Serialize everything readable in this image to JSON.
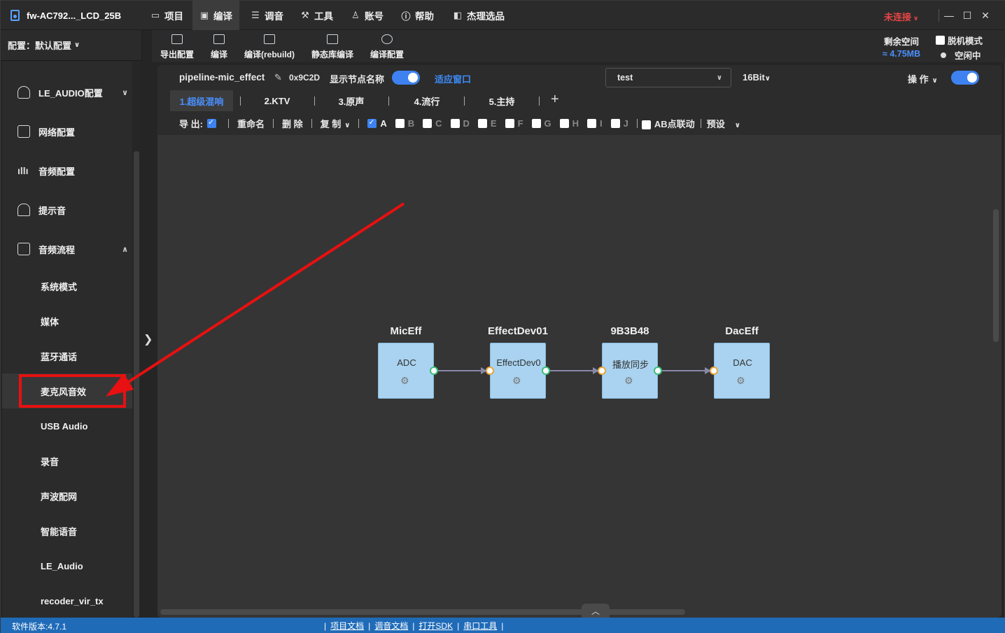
{
  "title_bar": {
    "app_title": "fw-AC792..._LCD_25B",
    "menus": [
      {
        "label": "项目",
        "icon": "folder-icon"
      },
      {
        "label": "编译",
        "icon": "compile-icon"
      },
      {
        "label": "调音",
        "icon": "document-icon"
      },
      {
        "label": "工具",
        "icon": "tools-icon"
      },
      {
        "label": "账号",
        "icon": "user-icon"
      },
      {
        "label": "帮助",
        "icon": "help-icon"
      },
      {
        "label": "杰理选品",
        "icon": "product-icon"
      }
    ],
    "active_menu": "编译",
    "connection_status": "未连接",
    "connection_color": "#e84545"
  },
  "config_selector": {
    "label": "配置：默认配置"
  },
  "toolbar": {
    "buttons": [
      {
        "label": "导出配置",
        "icon": "export-icon"
      },
      {
        "label": "编译",
        "icon": "compile-icon"
      },
      {
        "label": "编译(rebuild)",
        "icon": "rebuild-icon"
      },
      {
        "label": "静态库编译",
        "icon": "static-lib-icon"
      },
      {
        "label": "编译配置",
        "icon": "gear-icon"
      }
    ],
    "space_label": "剩余空间",
    "space_value": "≈ 4.75MB",
    "offline_label": "脱机模式",
    "idle_label": "空闲中"
  },
  "sidebar": {
    "sections": [
      {
        "label": "LE_AUDIO配置",
        "icon": "headset-icon",
        "expanded": false
      },
      {
        "label": "网络配置",
        "icon": "document-icon"
      },
      {
        "label": "音频配置",
        "icon": "audio-wave-icon"
      },
      {
        "label": "提示音",
        "icon": "bell-icon"
      },
      {
        "label": "音频流程",
        "icon": "flow-icon",
        "expanded": true
      }
    ],
    "sub_items": [
      "系统模式",
      "媒体",
      "蓝牙通话",
      "麦克风音效",
      "USB Audio",
      "录音",
      "声波配网",
      "智能语音",
      "LE_Audio",
      "recoder_vir_tx"
    ],
    "active_sub_item": "麦克风音效"
  },
  "pipeline": {
    "name": "pipeline-mic_effect",
    "id": "0x9C2D",
    "show_node_name_label": "显示节点名称",
    "show_node_name": true,
    "fit_window_label": "适应窗口",
    "mode_select": "test",
    "bit_select": "16Bit",
    "ops_label": "操 作",
    "ops_toggle": true,
    "tabs": [
      "1.超级混响",
      "2.KTV",
      "3.原声",
      "4.流行",
      "5.主持"
    ],
    "active_tab": "1.超级混响",
    "row": {
      "export_label": "导 出:",
      "export_checked": true,
      "rename": "重命名",
      "delete": "删 除",
      "copy": "复 制",
      "slots": [
        {
          "label": "A",
          "checked": true
        },
        {
          "label": "B",
          "checked": false
        },
        {
          "label": "C",
          "checked": false
        },
        {
          "label": "D",
          "checked": false
        },
        {
          "label": "E",
          "checked": false
        },
        {
          "label": "F",
          "checked": false
        },
        {
          "label": "G",
          "checked": false
        },
        {
          "label": "H",
          "checked": false
        },
        {
          "label": "I",
          "checked": false
        },
        {
          "label": "J",
          "checked": false
        }
      ],
      "ab_link": "AB点联动",
      "preset": "预设"
    }
  },
  "graph": {
    "nodes": [
      {
        "title": "MicEff",
        "label": "ADC"
      },
      {
        "title": "EffectDev01",
        "label": "EffectDev0"
      },
      {
        "title": "9B3B48",
        "label": "播放同步"
      },
      {
        "title": "DacEff",
        "label": "DAC"
      }
    ]
  },
  "status_bar": {
    "version": "软件版本:4.7.1",
    "links": [
      "项目文档",
      "调音文档",
      "打开SDK",
      "串口工具"
    ]
  },
  "annotation": {
    "color": "#e81010"
  }
}
